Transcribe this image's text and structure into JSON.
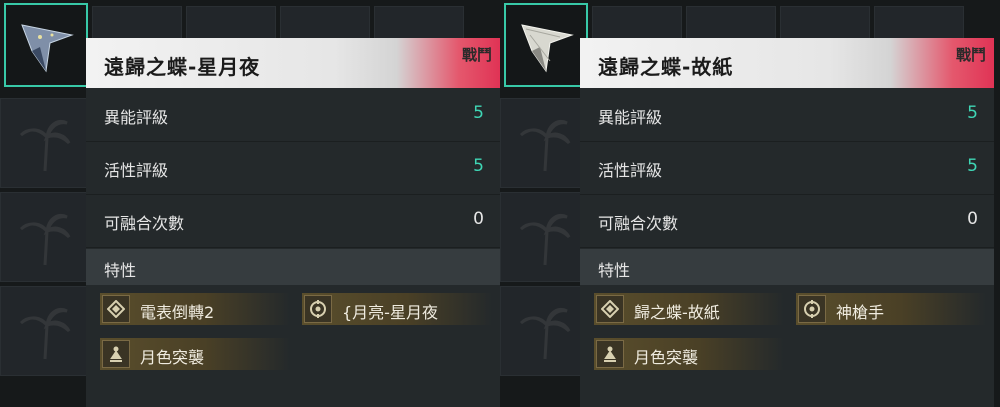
{
  "cards": [
    {
      "title": "遠歸之蝶-星月夜",
      "badge": "戰鬥",
      "stats": [
        {
          "label": "異能評級",
          "value": "5",
          "accent": "teal"
        },
        {
          "label": "活性評級",
          "value": "5",
          "accent": "teal"
        },
        {
          "label": "可融合次數",
          "value": "0",
          "accent": "white"
        }
      ],
      "traits_header": "特性",
      "traits": [
        {
          "label": "電表倒轉2",
          "icon": "diamond-icon"
        },
        {
          "label": "{月亮-星月夜",
          "icon": "crosshair-icon"
        },
        {
          "label": "月色突襲",
          "icon": "figure-icon"
        }
      ]
    },
    {
      "title": "遠歸之蝶-故紙",
      "badge": "戰鬥",
      "stats": [
        {
          "label": "異能評級",
          "value": "5",
          "accent": "teal"
        },
        {
          "label": "活性評級",
          "value": "5",
          "accent": "teal"
        },
        {
          "label": "可融合次數",
          "value": "0",
          "accent": "white"
        }
      ],
      "traits_header": "特性",
      "traits": [
        {
          "label": "歸之蝶-故紙",
          "icon": "diamond-icon"
        },
        {
          "label": "神槍手",
          "icon": "crosshair-icon"
        },
        {
          "label": "月色突襲",
          "icon": "figure-icon"
        }
      ]
    }
  ],
  "colors": {
    "accent_teal": "#3fd6b5",
    "badge_red": "#e03355",
    "slot_border": "#38c9a8"
  }
}
